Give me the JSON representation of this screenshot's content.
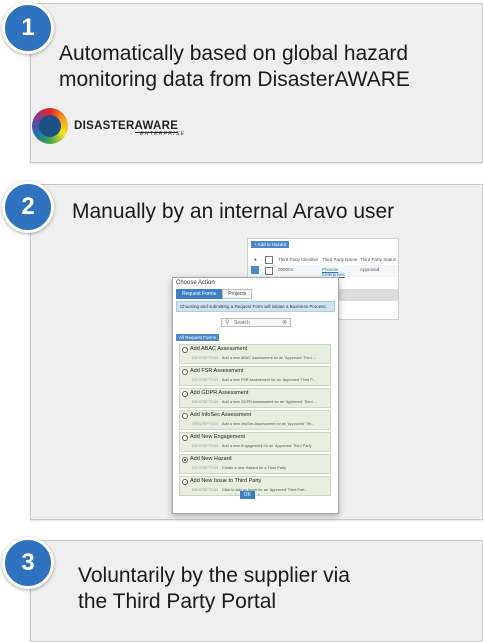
{
  "cards": [
    {
      "number": "1",
      "title_line1": "Automatically based on global hazard",
      "title_line2": "monitoring data from DisasterAWARE"
    },
    {
      "number": "2",
      "title": "Manually by an internal Aravo user"
    },
    {
      "number": "3",
      "title_line1": "Voluntarily by the supplier via",
      "title_line2": "the Third Party Portal"
    }
  ],
  "logo": {
    "name_part1": "DISASTER",
    "name_part2": "AWARE",
    "sub": "ENTERPRISE"
  },
  "bg_table": {
    "tag": "+ Add to Hazard",
    "headers": [
      "Third Party Identifier",
      "Third Party Name",
      "Third Party Status"
    ],
    "row": {
      "id": "000004",
      "name": "Phoenix Enterprises",
      "status": "Approved"
    }
  },
  "dialog": {
    "title": "Choose Action",
    "tabs": [
      "Request Forms",
      "Projects"
    ],
    "info": "Choosing and submitting a Request Form will initiate a Business Process.",
    "search_placeholder": "Search",
    "section_label": "All Request Forms",
    "items": [
      {
        "title": "Add ABAC Assessment",
        "desc": "Add a new ABAC Assessment for an 'Approved' Third ...",
        "selected": false
      },
      {
        "title": "Add FSR Assessment",
        "desc": "Add a new FSR Assessment for an 'Approved' Third P...",
        "selected": false
      },
      {
        "title": "Add GDPR Assessment",
        "desc": "Add a new GDPR Assessment for an 'Approved' Third ...",
        "selected": false
      },
      {
        "title": "Add InfoSec Assessment",
        "desc": "Add a new InfoSec Assessment for an 'Approved' Thi...",
        "selected": false
      },
      {
        "title": "Add New Engagement",
        "desc": "Add a new Engagement for an 'Approved' Third Party",
        "selected": false
      },
      {
        "title": "Add New Hazard",
        "desc": "Create a new Hazard for a Third Party",
        "selected": true
      },
      {
        "title": "Add New Issue to Third Party",
        "desc": "Click to add an Issue for an 'Approved' Third Part...",
        "selected": false
      }
    ],
    "desc_key": "DESCRIPTION",
    "pager_prev": "‹",
    "pager_ok": "OK",
    "pager_next": "›"
  },
  "colors": {
    "badge": "#2f73bf",
    "card_bg": "#efefef",
    "dialog_accent": "#3c7fc4",
    "item_bg": "#e6efdf"
  }
}
